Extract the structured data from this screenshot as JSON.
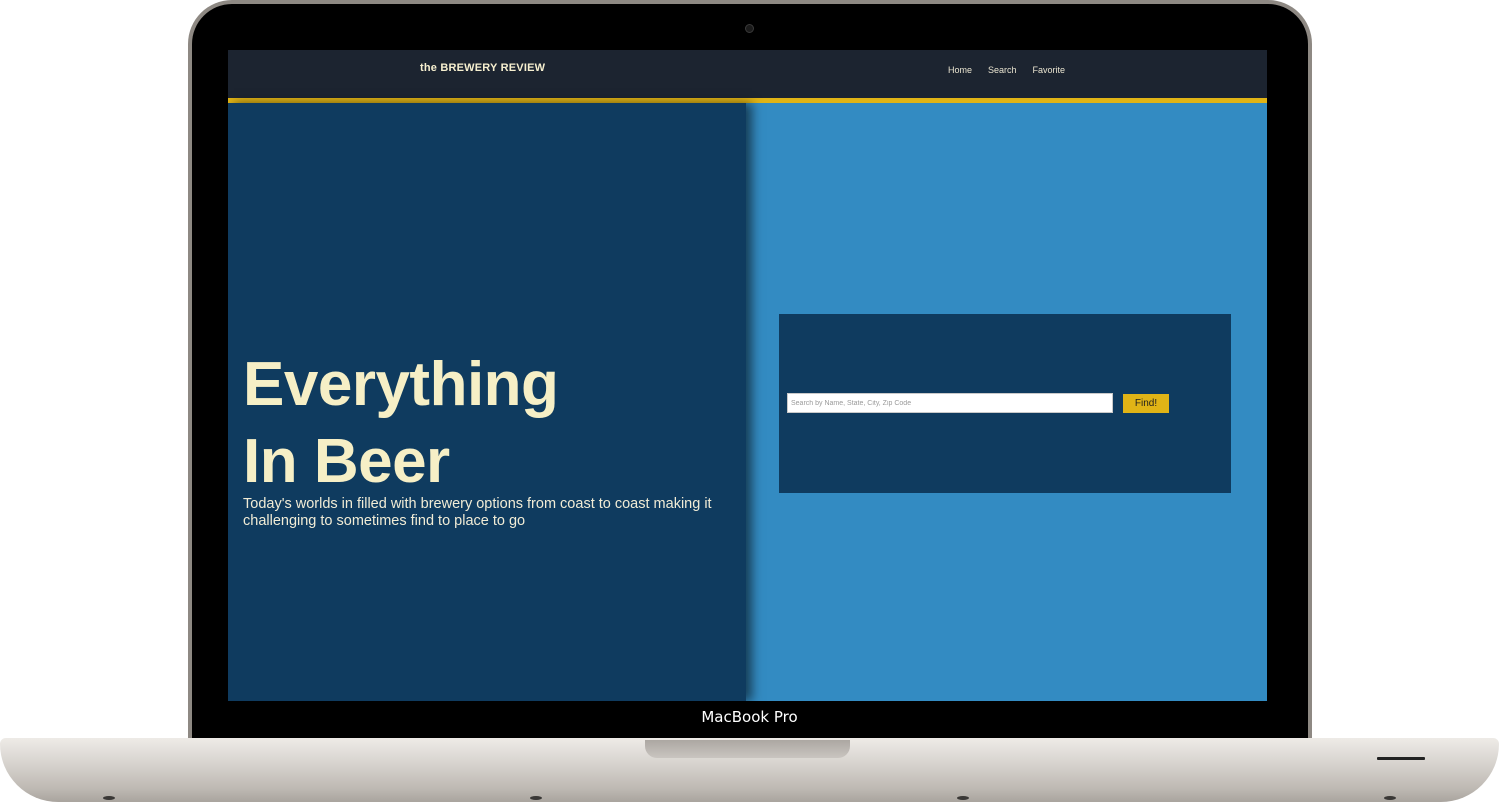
{
  "device": {
    "label": "MacBook Pro"
  },
  "navbar": {
    "brand": "the BREWERY REVIEW",
    "links": [
      "Home",
      "Search",
      "Favorite"
    ],
    "accent_color": "#e0b416",
    "background_color": "#1c2430"
  },
  "hero": {
    "title_line1": "Everything",
    "title_line2": "In Beer",
    "description": "Today's worlds in filled with brewery options from coast to coast making it challenging to sometimes find to place to go",
    "panel_color": "#0f3b5f",
    "title_color": "#f6efc6"
  },
  "search": {
    "placeholder": "Search by Name, State, City, Zip Code",
    "value": "",
    "button_label": "Find!",
    "button_color": "#e0b416",
    "background_color": "#338bc2"
  }
}
